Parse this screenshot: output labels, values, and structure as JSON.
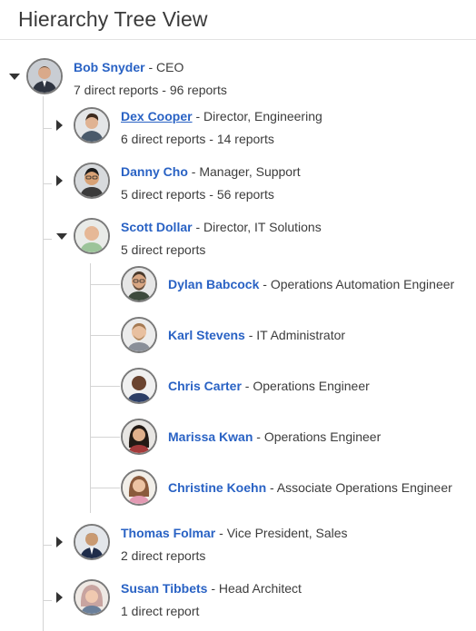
{
  "page": {
    "title": "Hierarchy Tree View"
  },
  "root": {
    "name": "Bob Snyder",
    "role": "CEO",
    "stats": "7 direct reports - 96 reports"
  },
  "children": [
    {
      "name": "Dex Cooper",
      "role": "Director, Engineering",
      "stats": "6 direct reports - 14 reports",
      "expanded": false
    },
    {
      "name": "Danny Cho",
      "role": "Manager, Support",
      "stats": "5 direct reports - 56 reports",
      "expanded": false
    },
    {
      "name": "Scott Dollar",
      "role": "Director, IT Solutions",
      "stats": "5 direct reports",
      "expanded": true
    },
    {
      "name": "Thomas Folmar",
      "role": "Vice President, Sales",
      "stats": "2 direct reports",
      "expanded": false
    },
    {
      "name": "Susan Tibbets",
      "role": "Head Architect",
      "stats": "1 direct report",
      "expanded": false
    }
  ],
  "grandchildren": [
    {
      "name": "Dylan Babcock",
      "role": "Operations Automation Engineer"
    },
    {
      "name": "Karl Stevens",
      "role": "IT Administrator"
    },
    {
      "name": "Chris Carter",
      "role": "Operations Engineer"
    },
    {
      "name": "Marissa Kwan",
      "role": "Operations Engineer"
    },
    {
      "name": "Christine Koehn",
      "role": "Associate Operations Engineer"
    }
  ],
  "separator": " - ",
  "colors": {
    "link": "#2962c4",
    "connector": "#d4d4d4",
    "avatar_border": "#7a7a7a"
  }
}
